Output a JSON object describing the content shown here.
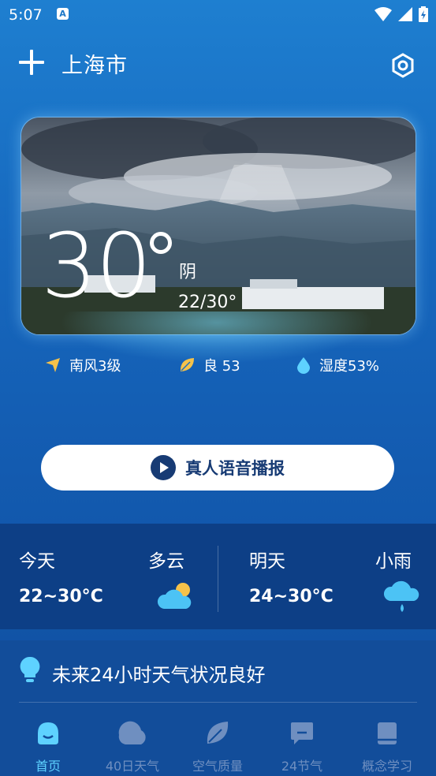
{
  "status_bar": {
    "time": "5:07",
    "badge": "A"
  },
  "header": {
    "city": "上海市"
  },
  "hero": {
    "temperature": "30",
    "condition": "阴",
    "range": "22/30°"
  },
  "stats": {
    "wind": "南风3级",
    "air_quality": "良 53",
    "humidity": "湿度53%"
  },
  "voice_button": {
    "label": "真人语音播报"
  },
  "forecast": {
    "today": {
      "day": "今天",
      "condition": "多云",
      "temp": "22~30°C",
      "icon": "partly-cloudy-icon"
    },
    "tomorrow": {
      "day": "明天",
      "condition": "小雨",
      "temp": "24~30°C",
      "icon": "light-rain-icon"
    }
  },
  "tip": {
    "text": "未来24小时天气状况良好"
  },
  "nav": [
    {
      "label": "首页",
      "icon": "home-icon",
      "active": true
    },
    {
      "label": "40日天气",
      "icon": "40-day-icon",
      "active": false
    },
    {
      "label": "空气质量",
      "icon": "leaf-icon",
      "active": false
    },
    {
      "label": "24节气",
      "icon": "solar-terms-icon",
      "active": false
    },
    {
      "label": "概念学习",
      "icon": "book-icon",
      "active": false
    }
  ],
  "colors": {
    "accent": "#5ed2ff",
    "button_text": "#173b74",
    "nav_inactive": "#6f8fc0"
  }
}
